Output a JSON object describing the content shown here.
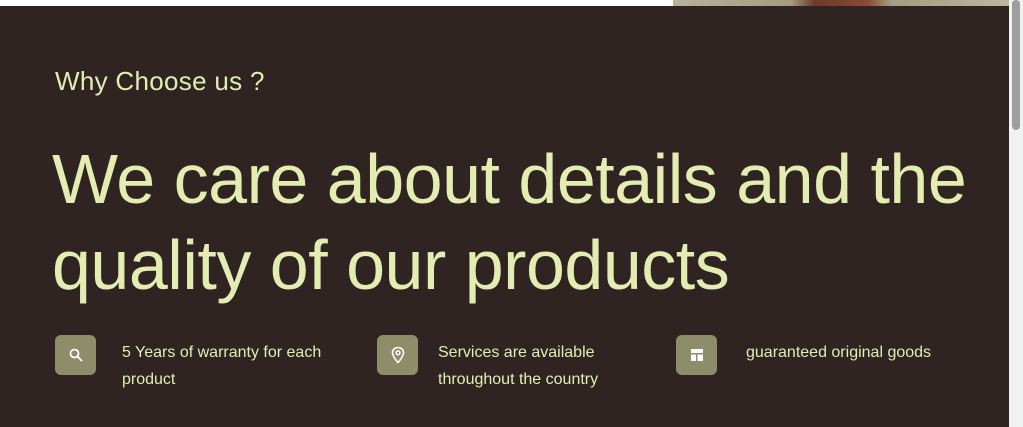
{
  "why": {
    "eyebrow": "Why Choose us ?",
    "headline": "We care about details and the quality of our products"
  },
  "features": [
    {
      "icon": "search-icon",
      "text": "5 Years of warranty for each product"
    },
    {
      "icon": "location-pin-icon",
      "text": "Services are available throughout the country"
    },
    {
      "icon": "layout-icon",
      "text": "guaranteed original goods"
    }
  ],
  "colors": {
    "background": "#2f2421",
    "text": "#e3edb2",
    "icon_box": "#8f8c6a"
  }
}
